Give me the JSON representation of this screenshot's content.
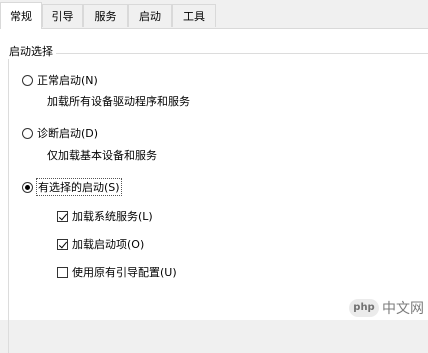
{
  "tabs": [
    {
      "label": "常规",
      "active": true
    },
    {
      "label": "引导",
      "active": false
    },
    {
      "label": "服务",
      "active": false
    },
    {
      "label": "启动",
      "active": false
    },
    {
      "label": "工具",
      "active": false
    }
  ],
  "group": {
    "title": "启动选择"
  },
  "options": {
    "normal": {
      "label": "正常启动(N)",
      "description": "加载所有设备驱动程序和服务",
      "selected": false
    },
    "diagnostic": {
      "label": "诊断启动(D)",
      "description": "仅加载基本设备和服务",
      "selected": false
    },
    "selective": {
      "label": "有选择的启动(S)",
      "selected": true
    }
  },
  "checkboxes": {
    "system_services": {
      "label": "加载系统服务(L)",
      "checked": true
    },
    "startup_items": {
      "label": "加载启动项(O)",
      "checked": true
    },
    "original_boot": {
      "label": "使用原有引导配置(U)",
      "checked": false
    }
  },
  "watermark": {
    "badge": "php",
    "text": "中文网"
  }
}
